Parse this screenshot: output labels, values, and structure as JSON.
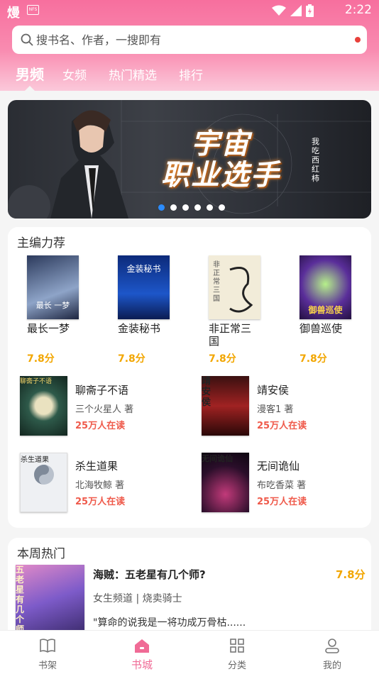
{
  "status_bar": {
    "app_logo": "熳",
    "mini_badge": "NFS",
    "time": "2:22"
  },
  "search": {
    "placeholder": "搜书名、作者，一搜即有"
  },
  "tabs": [
    {
      "label": "男频",
      "active": true
    },
    {
      "label": "女频",
      "active": false
    },
    {
      "label": "热门精选",
      "active": false
    },
    {
      "label": "排行",
      "active": false
    }
  ],
  "banner": {
    "title_line1": "宇宙",
    "title_line2": "职业选手",
    "author_vertical": "我吃西红柿",
    "dots": 6,
    "active_dot": 0
  },
  "featured": {
    "title": "主编力荐",
    "books": [
      {
        "title": "最长一梦",
        "score": "7.8分",
        "cover_text": "最长 一梦"
      },
      {
        "title": "金装秘书",
        "score": "7.8分",
        "cover_text": "金装秘书"
      },
      {
        "title": "非正常三国",
        "score": "7.8分",
        "cover_text": "非正常三国"
      },
      {
        "title": "御兽巡使",
        "score": "7.8分",
        "cover_text": "御兽巡使"
      }
    ],
    "list": [
      {
        "title": "聊斋子不语",
        "author": "三个火星人 著",
        "readers": "25万人在读",
        "cover_text": "聊斋子不语"
      },
      {
        "title": "靖安侯",
        "author": "漫客1 著",
        "readers": "25万人在读",
        "cover_text": "靖安侯"
      },
      {
        "title": "杀生道果",
        "author": "北海牧鲸 著",
        "readers": "25万人在读",
        "cover_text": "杀生道果"
      },
      {
        "title": "无间诡仙",
        "author": "布吃香菜 著",
        "readers": "25万人在读",
        "cover_text": "无间诡仙"
      }
    ]
  },
  "weekly": {
    "title": "本周热门",
    "book": {
      "title": "海贼：五老星有几个师?",
      "score": "7.8分",
      "meta": "女生频道 | 烧卖骑士",
      "desc": "\"算命的说我是一将功成万骨枯......",
      "cover_text": "五老星有几个师"
    }
  },
  "bottom_nav": [
    {
      "label": "书架",
      "icon": "bookshelf-icon",
      "active": false
    },
    {
      "label": "书城",
      "icon": "bookstore-icon",
      "active": true
    },
    {
      "label": "分类",
      "icon": "category-icon",
      "active": false
    },
    {
      "label": "我的",
      "icon": "profile-icon",
      "active": false
    }
  ],
  "colors": {
    "accent": "#f06b96",
    "score": "#f2a600",
    "readers": "#ef5a4b"
  }
}
